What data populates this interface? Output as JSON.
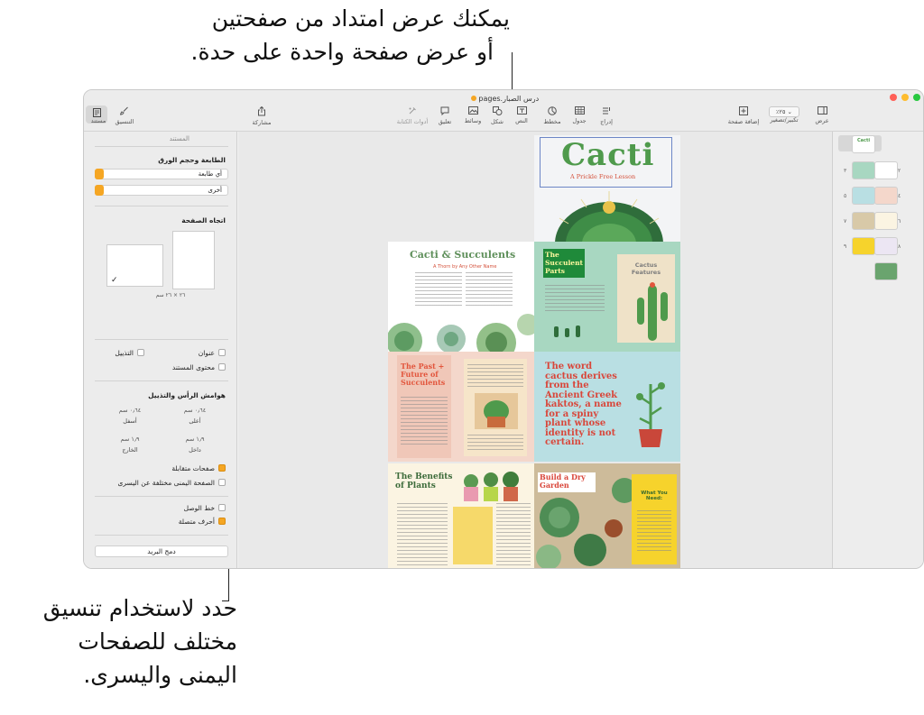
{
  "callouts": {
    "top_line1": "يمكنك عرض امتداد من صفحتين",
    "top_line2": "أو عرض صفحة واحدة على حدة.",
    "bottom_line1": "حدد لاستخدام تنسيق",
    "bottom_line2": "مختلف للصفحات",
    "bottom_line3": "اليمنى واليسرى."
  },
  "window": {
    "title": "درس الصبار.pages",
    "toolbar": {
      "view": "عرض",
      "zoom": "تكبير/تصغير",
      "zoom_value": "٪٢٥",
      "add_page": "إضافة صفحة",
      "insert": "إدراج",
      "table": "جدول",
      "chart": "مخطط",
      "text": "النص",
      "shape": "شكل",
      "media": "وسائط",
      "comment": "تعليق",
      "writing_tools": "أدوات الكتابة",
      "share": "مشاركة",
      "format": "التنسيق",
      "document": "مستند"
    }
  },
  "inspector": {
    "tab_label": "المستند",
    "printer_title": "الطابعة وحجم الورق",
    "printer_value": "أي طابعة",
    "paper_value": "أخرى",
    "orientation_title": "اتجاه الصفحة",
    "paper_size": "٢٦ × ٢٦ سم",
    "header": "عنوان",
    "footer": "التذييل",
    "body": "محتوى المستند",
    "margins_title": "هوامش الرأس والتذييل",
    "top_value": "٠٫٦٤ سم",
    "top_label": "أعلى",
    "bottom_value": "٠٫٦٤ سم",
    "bottom_label": "أسفل",
    "inside_value": "١٫٩ سم",
    "inside_label": "داخل",
    "outside_value": "١٫٩ سم",
    "outside_label": "الخارج",
    "facing_pages": "صفحات متقابلة",
    "left_right_different": "الصفحة اليمنى مختلفة عن اليسرى",
    "hyphenation": "خط الوصل",
    "ligatures": "أحرف متصلة",
    "mail_merge": "دمج البريد",
    "facing_pages_checked": true,
    "left_right_different_checked": false,
    "ligatures_checked": true
  },
  "pages": {
    "cover_title": "Cacti",
    "cover_subtitle": "A Prickle Free Lesson",
    "p2_title": "Cacti & Succulents",
    "p2_subtitle": "A Thorn by Any Other Name",
    "p3_title": "The Succulent Parts",
    "p3_box": "Cactus Features",
    "p4_title": "The Past + Future of Succulents",
    "p5_text": "The word cactus derives from the Ancient Greek kaktos, a name for a spiny plant whose identity is not certain.",
    "p6_title": "The Benefits of Plants",
    "p7_title": "Build a Dry Garden",
    "p7_box": "What You Need:"
  },
  "thumbnails": {
    "cover_label": "Cacti",
    "numbers": [
      "٢",
      "٣",
      "٤",
      "٥",
      "٦",
      "٧",
      "٨",
      "٩"
    ]
  },
  "colors": {
    "accent": "#f5a623",
    "cacti_green": "#3f8a3f",
    "title_pink": "#e2553c",
    "mint": "#a8d7c1",
    "sky": "#b9dfe3",
    "sand": "#efe2c8",
    "yellow": "#f6d32c"
  }
}
